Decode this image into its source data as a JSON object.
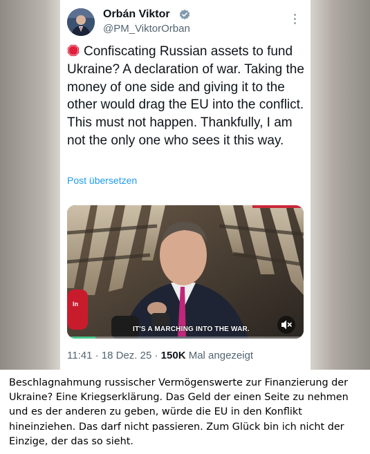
{
  "tweet": {
    "author_name": "Orbán Viktor",
    "handle": "@PM_ViktorOrban",
    "text": "Confiscating Russian assets to fund Ukraine? A declaration of war. Taking the money of one side and giving it to the other would drag the EU into the conflict. This must not happen. Thankfully, I am not the only one who sees it this way.",
    "translate_link": "Post übersetzen",
    "media": {
      "caption": "IT'S A MARCHING INTO THE WAR.",
      "progress": 0.12
    },
    "meta": {
      "time": "11:41",
      "separator": "·",
      "date": "18 Dez. 25",
      "views_count": "150K",
      "views_label": "Mal angezeigt"
    }
  },
  "translation": {
    "text": "Beschlagnahmung russischer Vermögenswerte zur Finanzierung der Ukraine? Eine Kriegserklärung. Das Geld der einen Seite zu nehmen und es der anderen zu geben, würde die EU in den Konflikt hineinziehen. Das darf nicht passieren. Zum Glück bin ich nicht der Einzige, der das so sieht."
  },
  "icons": {
    "verified": "verified-badge-icon",
    "more": "more-vertical-icon",
    "stop": "stop-sign-icon",
    "mute": "speaker-muted-icon"
  },
  "colors": {
    "link": "#1d9bf0",
    "verified": "#829aab",
    "text": "#0f1419",
    "muted": "#536471"
  }
}
